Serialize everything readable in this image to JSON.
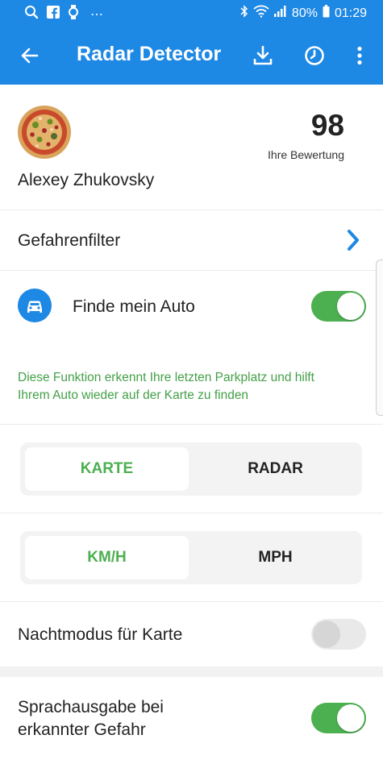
{
  "status_bar": {
    "battery": "80%",
    "time": "01:29",
    "more_indicator": "⋯"
  },
  "app_bar": {
    "title": "Radar Detector"
  },
  "profile": {
    "name": "Alexey Zhukovsky",
    "score": "98",
    "score_label": "Ihre Bewertung"
  },
  "danger_filter": {
    "label": "Gefahrenfilter"
  },
  "find_car": {
    "label": "Finde mein Auto",
    "enabled": true,
    "description_line1": "Diese Funktion erkennt Ihre letzten Parkplatz und hilft",
    "description_line2": "Ihrem Auto wieder auf der Karte zu finden"
  },
  "view_mode": {
    "options": [
      "KARTE",
      "RADAR"
    ],
    "selected": "KARTE"
  },
  "units": {
    "options": [
      "KM/H",
      "MPH"
    ],
    "selected": "KM/H"
  },
  "night_mode": {
    "label": "Nachtmodus für Karte",
    "enabled": false
  },
  "voice_alert": {
    "label_line1": "Sprachausgabe bei",
    "label_line2": "erkannter Gefahr",
    "enabled": true
  },
  "colors": {
    "primary": "#1e88e5",
    "accent_green": "#4caf50",
    "description_green": "#43a047"
  }
}
